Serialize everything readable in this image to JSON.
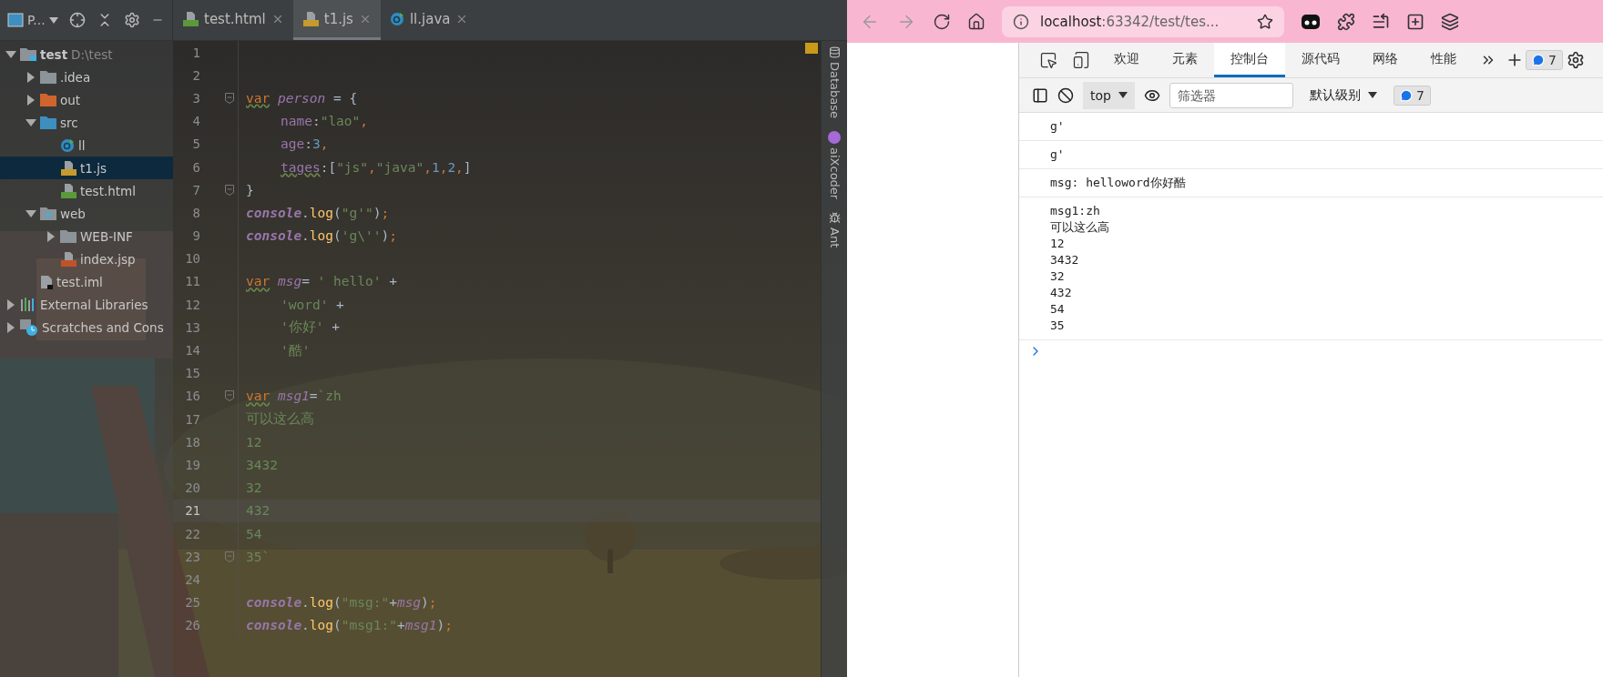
{
  "ide": {
    "project_selector": {
      "label": "P..."
    },
    "tabs": [
      {
        "label": "test.html",
        "kind": "html",
        "selected": false
      },
      {
        "label": "t1.js",
        "kind": "js",
        "selected": true
      },
      {
        "label": "ll.java",
        "kind": "java",
        "selected": false
      }
    ],
    "project_tree": [
      {
        "label": "test",
        "hint": "D:\\test",
        "kind": "project",
        "expanded": true,
        "selected": false,
        "children": [
          {
            "label": ".idea",
            "kind": "folder",
            "expanded": false,
            "selected": false
          },
          {
            "label": "out",
            "kind": "excluded",
            "expanded": false,
            "selected": false
          },
          {
            "label": "src",
            "kind": "source",
            "expanded": true,
            "selected": false,
            "children": [
              {
                "label": "ll",
                "kind": "java",
                "selected": false
              },
              {
                "label": "t1.js",
                "kind": "js",
                "selected": true
              },
              {
                "label": "test.html",
                "kind": "html",
                "selected": false
              }
            ]
          },
          {
            "label": "web",
            "kind": "web",
            "expanded": true,
            "selected": false,
            "children": [
              {
                "label": "WEB-INF",
                "kind": "folder",
                "expanded": false,
                "selected": false
              },
              {
                "label": "index.jsp",
                "kind": "jsp",
                "selected": false
              }
            ]
          },
          {
            "label": "test.iml",
            "kind": "iml",
            "selected": false
          }
        ]
      },
      {
        "label": "External Libraries",
        "kind": "libraries",
        "expanded": false,
        "selected": false
      },
      {
        "label": "Scratches and Cons",
        "kind": "scratches",
        "expanded": false,
        "selected": false
      }
    ],
    "editor": {
      "lines": [
        {
          "number": "1"
        },
        {
          "number": "2"
        },
        {
          "number": "3",
          "fold": true,
          "tokens": [
            {
              "text": "var",
              "kind": "kw",
              "warn": true
            },
            {
              "text": " person",
              "kind": "var"
            },
            {
              "text": " = {",
              "kind": "plain"
            }
          ]
        },
        {
          "number": "4",
          "indented": true,
          "tokens": [
            {
              "text": "name",
              "kind": "prop"
            },
            {
              "text": ":",
              "kind": "plain"
            },
            {
              "text": "\"lao\"",
              "kind": "str"
            },
            {
              "text": ",",
              "kind": "punct"
            }
          ]
        },
        {
          "number": "5",
          "indented": true,
          "tokens": [
            {
              "text": "age",
              "kind": "prop"
            },
            {
              "text": ":",
              "kind": "plain"
            },
            {
              "text": "3",
              "kind": "num"
            },
            {
              "text": ",",
              "kind": "punct"
            }
          ]
        },
        {
          "number": "6",
          "indented": true,
          "tokens": [
            {
              "text": "tages",
              "kind": "prop",
              "warn": true
            },
            {
              "text": ":[",
              "kind": "plain"
            },
            {
              "text": "\"js\"",
              "kind": "str"
            },
            {
              "text": ",",
              "kind": "punct"
            },
            {
              "text": "\"java\"",
              "kind": "str"
            },
            {
              "text": ",",
              "kind": "punct"
            },
            {
              "text": "1",
              "kind": "num"
            },
            {
              "text": ",",
              "kind": "punct"
            },
            {
              "text": "2",
              "kind": "num"
            },
            {
              "text": ",",
              "kind": "punct"
            },
            {
              "text": "]",
              "kind": "plain"
            }
          ]
        },
        {
          "number": "7",
          "fold": true,
          "tokens": [
            {
              "text": "}",
              "kind": "plain"
            }
          ]
        },
        {
          "number": "8",
          "tokens": [
            {
              "text": "console",
              "kind": "obj"
            },
            {
              "text": ".",
              "kind": "plain"
            },
            {
              "text": "log",
              "kind": "fn"
            },
            {
              "text": "(",
              "kind": "plain"
            },
            {
              "text": "\"g'\"",
              "kind": "str"
            },
            {
              "text": ")",
              "kind": "plain"
            },
            {
              "text": ";",
              "kind": "punct"
            }
          ]
        },
        {
          "number": "9",
          "tokens": [
            {
              "text": "console",
              "kind": "obj"
            },
            {
              "text": ".",
              "kind": "plain"
            },
            {
              "text": "log",
              "kind": "fn"
            },
            {
              "text": "(",
              "kind": "plain"
            },
            {
              "text": "'g\\''",
              "kind": "str"
            },
            {
              "text": ")",
              "kind": "plain"
            },
            {
              "text": ";",
              "kind": "punct"
            }
          ]
        },
        {
          "number": "10"
        },
        {
          "number": "11",
          "tokens": [
            {
              "text": "var",
              "kind": "kw",
              "warn": true
            },
            {
              "text": " msg",
              "kind": "var"
            },
            {
              "text": "= ",
              "kind": "plain"
            },
            {
              "text": "' hello'",
              "kind": "str"
            },
            {
              "text": " +",
              "kind": "plain"
            }
          ]
        },
        {
          "number": "12",
          "indented": true,
          "tokens": [
            {
              "text": "'word'",
              "kind": "str"
            },
            {
              "text": " +",
              "kind": "plain"
            }
          ]
        },
        {
          "number": "13",
          "indented": true,
          "tokens": [
            {
              "text": "'你好'",
              "kind": "str"
            },
            {
              "text": " +",
              "kind": "plain"
            }
          ]
        },
        {
          "number": "14",
          "indented": true,
          "tokens": [
            {
              "text": "'酷'",
              "kind": "str"
            }
          ]
        },
        {
          "number": "15"
        },
        {
          "number": "16",
          "fold": true,
          "tokens": [
            {
              "text": "var",
              "kind": "kw",
              "warn": true
            },
            {
              "text": " msg1",
              "kind": "var"
            },
            {
              "text": "=",
              "kind": "plain"
            },
            {
              "text": "`zh",
              "kind": "str"
            }
          ]
        },
        {
          "number": "17",
          "tokens": [
            {
              "text": "可以这么高",
              "kind": "str"
            }
          ]
        },
        {
          "number": "18",
          "tokens": [
            {
              "text": "12",
              "kind": "str"
            }
          ]
        },
        {
          "number": "19",
          "tokens": [
            {
              "text": "3432",
              "kind": "str"
            }
          ]
        },
        {
          "number": "20",
          "tokens": [
            {
              "text": "32",
              "kind": "str"
            }
          ]
        },
        {
          "number": "21",
          "current": true,
          "tokens": [
            {
              "text": "432",
              "kind": "str"
            }
          ]
        },
        {
          "number": "22",
          "tokens": [
            {
              "text": "54",
              "kind": "str"
            }
          ]
        },
        {
          "number": "23",
          "fold": true,
          "tokens": [
            {
              "text": "35`",
              "kind": "str"
            }
          ]
        },
        {
          "number": "24"
        },
        {
          "number": "25",
          "tokens": [
            {
              "text": "console",
              "kind": "obj"
            },
            {
              "text": ".",
              "kind": "plain"
            },
            {
              "text": "log",
              "kind": "fn"
            },
            {
              "text": "(",
              "kind": "plain"
            },
            {
              "text": "\"msg:\"",
              "kind": "str"
            },
            {
              "text": "+",
              "kind": "plain"
            },
            {
              "text": "msg",
              "kind": "var"
            },
            {
              "text": ")",
              "kind": "plain"
            },
            {
              "text": ";",
              "kind": "punct"
            }
          ]
        },
        {
          "number": "26",
          "tokens": [
            {
              "text": "console",
              "kind": "obj"
            },
            {
              "text": ".",
              "kind": "plain"
            },
            {
              "text": "log",
              "kind": "fn"
            },
            {
              "text": "(",
              "kind": "plain"
            },
            {
              "text": "\"msg1:\"",
              "kind": "str"
            },
            {
              "text": "+",
              "kind": "plain"
            },
            {
              "text": "msg1",
              "kind": "var"
            },
            {
              "text": ")",
              "kind": "plain"
            },
            {
              "text": ";",
              "kind": "punct"
            }
          ]
        }
      ]
    },
    "tool_strip": [
      {
        "label": "Database",
        "kind": "database"
      },
      {
        "label": "aiXcoder",
        "kind": "aixcoder"
      },
      {
        "label": "Ant",
        "kind": "ant"
      }
    ]
  },
  "browser": {
    "address": {
      "host": "localhost",
      "path": ":63342/test/tes..."
    },
    "devtools": {
      "tabs": [
        {
          "label": "欢迎",
          "selected": false
        },
        {
          "label": "元素",
          "selected": false
        },
        {
          "label": "控制台",
          "selected": true
        },
        {
          "label": "源代码",
          "selected": false
        },
        {
          "label": "网络",
          "selected": false
        },
        {
          "label": "性能",
          "selected": false
        }
      ],
      "issues_count": "7",
      "context": "top",
      "filter": {
        "placeholder": "筛选器"
      },
      "log_level": "默认级别",
      "messages_count": "7",
      "console": [
        "g'",
        "g'",
        "msg: helloword你好酷",
        "msg1:zh\n可以这么高\n12\n3432\n32\n432\n54\n35"
      ]
    }
  }
}
